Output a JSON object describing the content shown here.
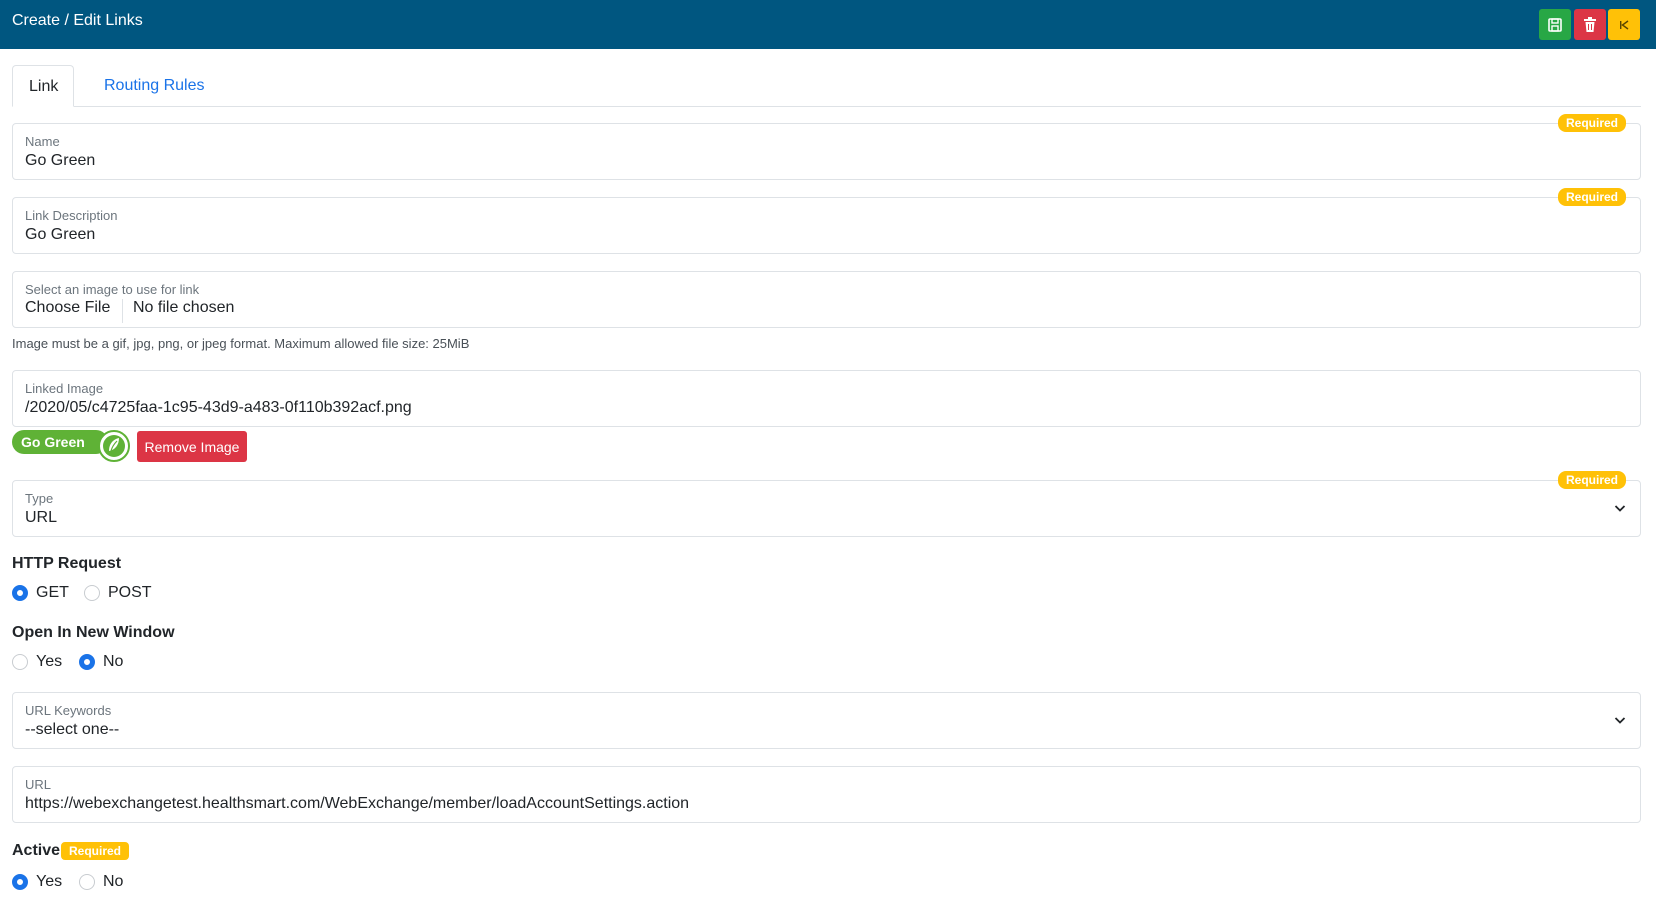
{
  "header": {
    "title": "Create / Edit Links",
    "colors": {
      "bar": "#005680",
      "save": "#28a745",
      "delete": "#dc3545",
      "back": "#ffc107"
    }
  },
  "tabs": [
    {
      "label": "Link",
      "active": true
    },
    {
      "label": "Routing Rules",
      "active": false
    }
  ],
  "required_label": "Required",
  "fields": {
    "name": {
      "label": "Name",
      "value": "Go Green"
    },
    "description": {
      "label": "Link Description",
      "value": "Go Green"
    },
    "image_upload": {
      "label": "Select an image to use for link",
      "button": "Choose File",
      "status": "No file chosen",
      "help": "Image must be a gif, jpg, png, or jpeg format. Maximum allowed file size: 25MiB"
    },
    "linked_image": {
      "label": "Linked Image",
      "value": "/2020/05/c4725faa-1c95-43d9-a483-0f110b392acf.png",
      "logo_text": "Go Green",
      "remove_button": "Remove Image"
    },
    "type": {
      "label": "Type",
      "value": "URL"
    },
    "url_keywords": {
      "label": "URL Keywords",
      "value": "--select one--"
    },
    "url": {
      "label": "URL",
      "value": "https://webexchangetest.healthsmart.com/WebExchange/member/loadAccountSettings.action"
    }
  },
  "http_request": {
    "label": "HTTP Request",
    "options": [
      "GET",
      "POST"
    ],
    "selected": "GET"
  },
  "open_new_window": {
    "label": "Open In New Window",
    "options": [
      "Yes",
      "No"
    ],
    "selected": "No"
  },
  "active": {
    "label": "Active",
    "options": [
      "Yes",
      "No"
    ],
    "selected": "Yes"
  }
}
